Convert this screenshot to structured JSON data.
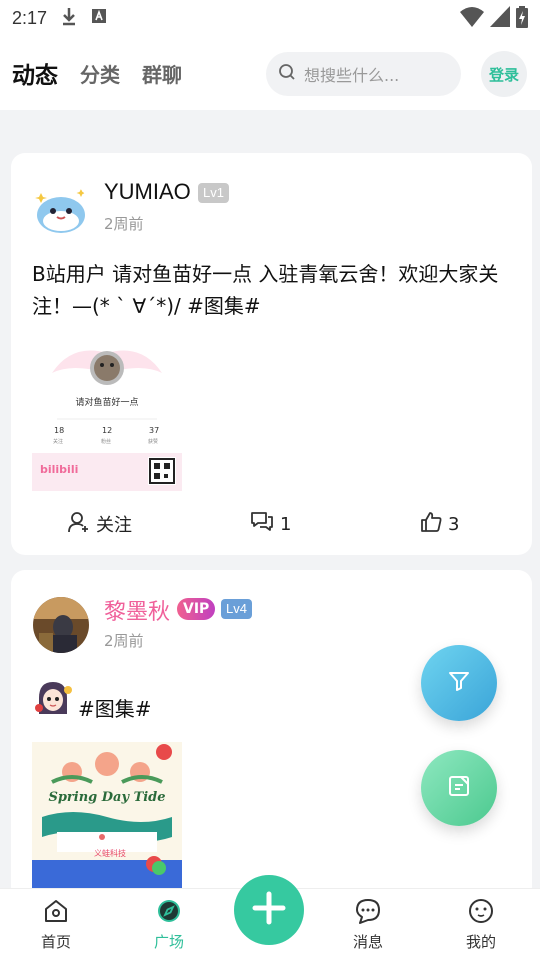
{
  "status_bar": {
    "time": "2:17"
  },
  "header": {
    "tabs": [
      {
        "label": "动态",
        "active": true
      },
      {
        "label": "分类",
        "active": false
      },
      {
        "label": "群聊",
        "active": false
      }
    ],
    "search_placeholder": "想搜些什么...",
    "login_label": "登录"
  },
  "posts": [
    {
      "username": "YUMIAO",
      "level": "Lv1",
      "time_ago": "2周前",
      "content": "B站用户 请对鱼苗好一点 入驻青氧云舍！欢迎大家关注！—(* ` ∀´*)/ #图集#",
      "image": {
        "title": "请对鱼苗好一点",
        "stats": [
          "18",
          "12",
          "37"
        ],
        "stat_labels": [
          "关注",
          "粉丝",
          "获赞"
        ],
        "brand": "bilibili"
      },
      "actions": {
        "follow_label": "关注",
        "comments": "1",
        "likes": "3"
      }
    },
    {
      "username": "黎墨秋",
      "vip_label": "VIP",
      "level": "Lv4",
      "time_ago": "2周前",
      "content": "#图集#",
      "image": {
        "title": "Spring Day Tide",
        "footer": "义蛙科技"
      }
    }
  ],
  "bottom_nav": [
    {
      "label": "首页",
      "active": false
    },
    {
      "label": "广场",
      "active": true
    },
    {
      "label": "消息",
      "active": false
    },
    {
      "label": "我的",
      "active": false
    }
  ],
  "colors": {
    "accent": "#32c8a3",
    "pink": "#f0609a",
    "level_gray": "#c8c8c8",
    "level_blue": "#6a9fd8"
  }
}
